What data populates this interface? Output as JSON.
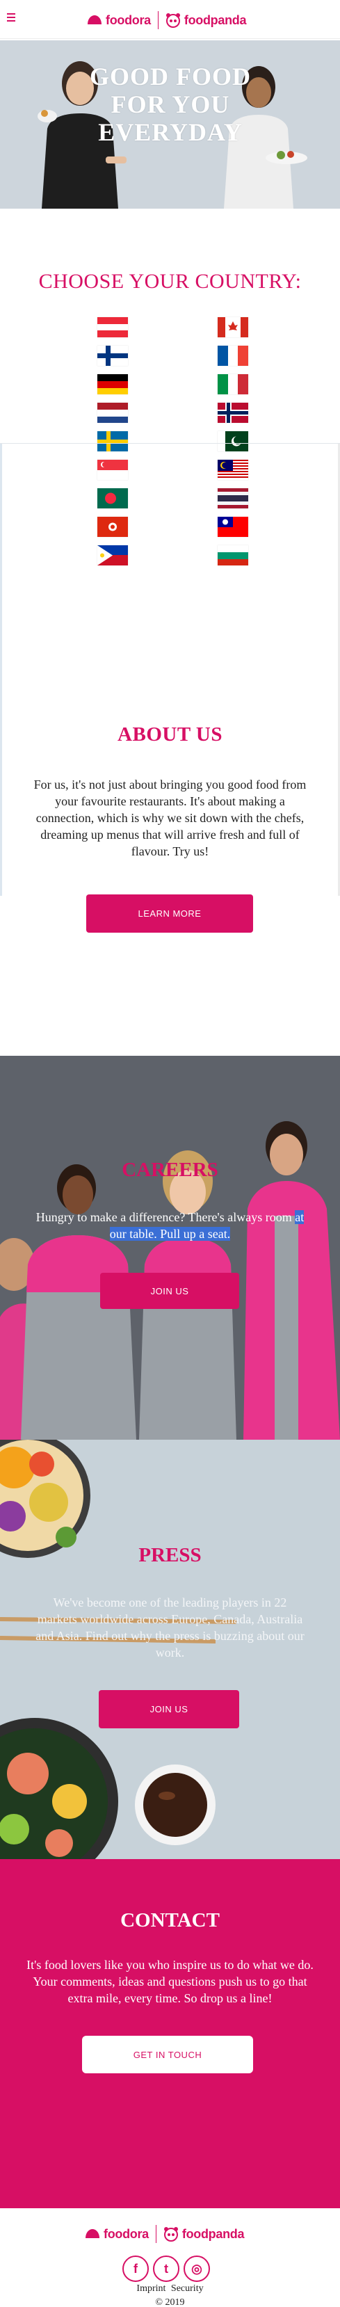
{
  "header": {
    "brand_foodora": "foodora",
    "brand_foodpanda": "foodpanda"
  },
  "hero": {
    "title": "GOOD FOOD FOR YOU EVERYDAY"
  },
  "countries": {
    "title": "CHOOSE YOUR COUNTRY:"
  },
  "about": {
    "title": "ABOUT US",
    "text": "For us, it's not just about bringing you good food from your favourite restaurants. It's about making a connection, which is why we sit down with the chefs, dreaming up menus that will arrive fresh and full of flavour. Try us!",
    "button": "LEARN MORE"
  },
  "careers": {
    "title": "CAREERS",
    "text_part1": "Hungry to make a difference? There's always room ",
    "text_part2": "at our table. Pull up a seat.",
    "button": "JOIN US"
  },
  "press": {
    "title": "PRESS",
    "text": "We've become one of the leading players in 22 markets worldwide across Europe, Canada, Australia and Asia. Find out why the press is buzzing about our work.",
    "button": "JOIN US"
  },
  "contact": {
    "title": "CONTACT",
    "text": "It's food lovers like you who inspire us to do what we do. Your comments, ideas and questions push us to go that extra mile, every time. So drop us a line!",
    "button": "GET IN TOUCH"
  },
  "footer": {
    "brand_foodora": "foodora",
    "brand_foodpanda": "foodpanda",
    "social_facebook": "f",
    "social_twitter": "t",
    "social_instagram": "◎",
    "link_imprint": "Imprint",
    "link_security": "Security",
    "copyright": "© 2019"
  },
  "colors": {
    "brand": "#d70f64",
    "hero_bg": "#cdd5dc",
    "press_bg": "#c7d2d9"
  }
}
